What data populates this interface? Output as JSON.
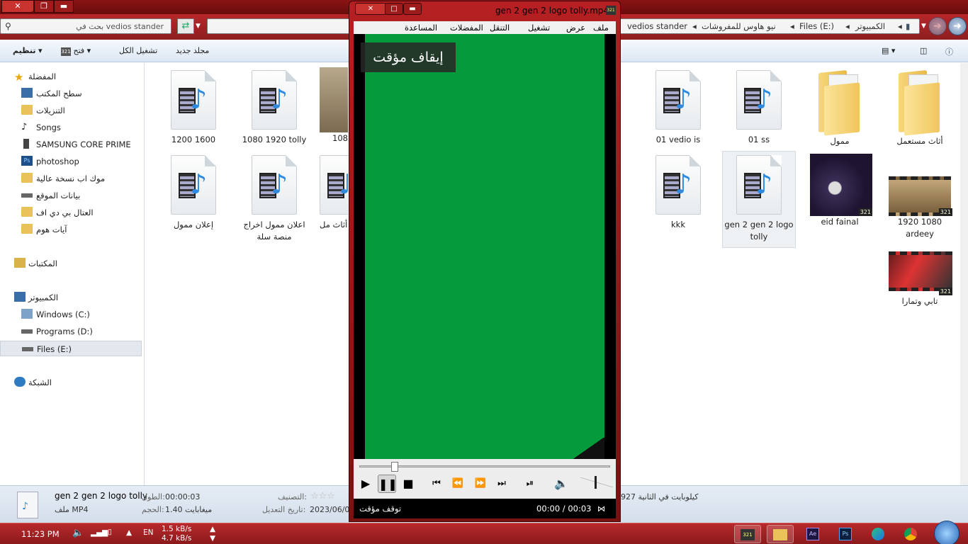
{
  "explorer": {
    "search_placeholder": "بحث في vedios stander",
    "breadcrumbs": [
      "الكمبيوتر",
      "Files (E:)",
      "نيو هاوس للمفروشات",
      "vedios stander"
    ],
    "toolbar": {
      "organize": "تنظيم",
      "open": "فتح",
      "play_all": "تشغيل الكل",
      "new_folder": "مجلد جديد"
    },
    "nav": {
      "favorites": "المفضلة",
      "desktop": "سطح المكتب",
      "downloads": "التنزيلات",
      "songs": "Songs",
      "samsung": "SAMSUNG CORE PRIME",
      "photoshop": "photoshop",
      "mockup": "موك اب نسخة عالية",
      "site_data": "بيانات الموقع",
      "pdf": "العتال بي دي اف",
      "ayat": "آيات هوم",
      "libraries": "المكتبات",
      "computer": "الكمبيوتر",
      "drive_c": "Windows (C:)",
      "drive_d": "Programs (D:)",
      "drive_e": "Files (E:)",
      "network": "الشبكة"
    },
    "files": [
      {
        "name": "أثاث مستعمل",
        "kind": "folder"
      },
      {
        "name": "ممول",
        "kind": "folder"
      },
      {
        "name": "01 ss",
        "kind": "video"
      },
      {
        "name": "01 vedio is",
        "kind": "video"
      },
      {
        "name": "108",
        "kind": "image"
      },
      {
        "name": "1080 1920 tolly",
        "kind": "video"
      },
      {
        "name": "1200 1600",
        "kind": "video"
      },
      {
        "name": "1920 1080 ardeey",
        "kind": "thumb"
      },
      {
        "name": "eid fainal",
        "kind": "thumb"
      },
      {
        "name": "gen 2 gen 2 logo tolly",
        "kind": "video",
        "selected": true
      },
      {
        "name": "kkk",
        "kind": "video"
      },
      {
        "name": "أثاث مل",
        "kind": "video"
      },
      {
        "name": "اعلان ممول اخراج منصة سلة",
        "kind": "video"
      },
      {
        "name": "إعلان ممول",
        "kind": "video"
      },
      {
        "name": "تابي وتمارا",
        "kind": "thumb"
      }
    ],
    "details": {
      "filename": "gen 2 gen 2 logo tolly",
      "filetype": "ملف MP4",
      "length_label": "الطول:",
      "length_value": "00:00:03",
      "size_label": "الحجم:",
      "size_value": "1.40 ميغابايت",
      "rating_label": "التصنيف:",
      "modified_label": "تاريخ التعديل:",
      "modified_value": "2023/06/0",
      "bitrate": "كيلوبايت في الثانية 927"
    }
  },
  "player": {
    "title": "gen 2 gen 2 logo tolly.mp4",
    "menu": [
      "ملف",
      "عرض",
      "تشغيل",
      "التنقل",
      "المفضلات",
      "المساعدة"
    ],
    "osd": "إيقاف مؤقت",
    "status": "توقف مؤقت",
    "time": "00:00 / 00:03",
    "seek_fraction": 0.14
  },
  "taskbar": {
    "clock": "11:23 PM",
    "lang": "EN",
    "net_up": "1.5 kB/s",
    "net_down": "4.7 kB/s"
  },
  "colors": {
    "aero": "#9e2224",
    "video": "#039b3b"
  }
}
